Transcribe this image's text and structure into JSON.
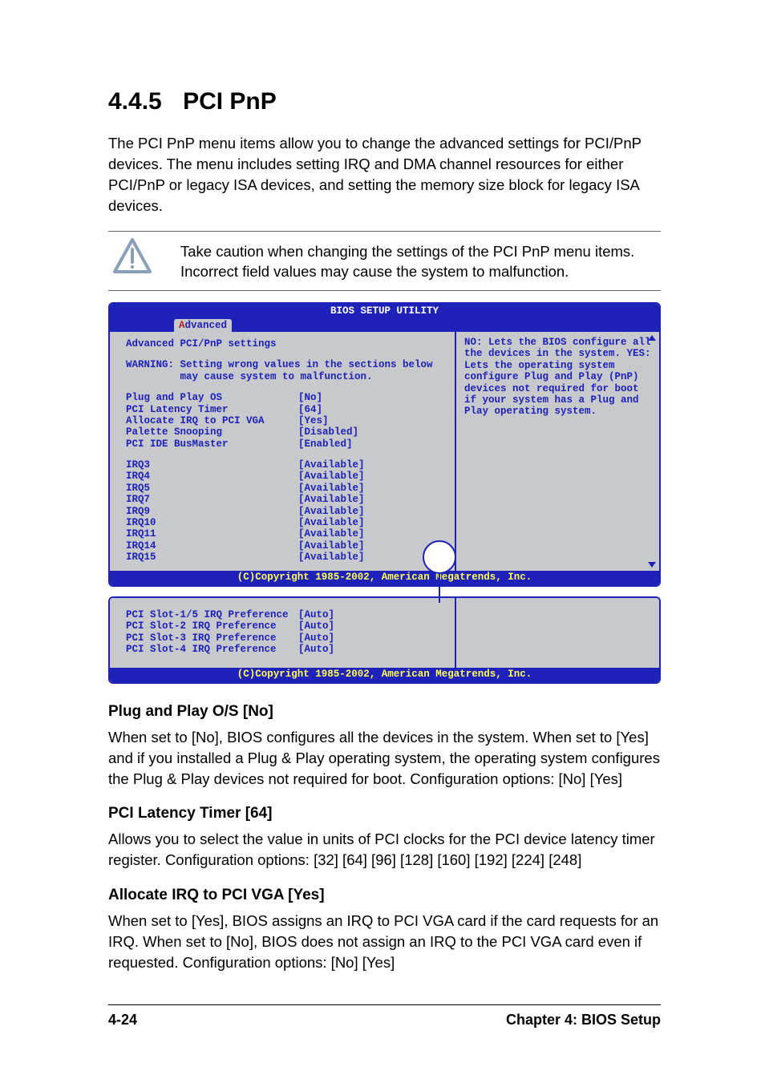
{
  "heading": {
    "num": "4.4.5",
    "title": "PCI PnP"
  },
  "intro": "The PCI PnP menu items allow you to change the advanced settings for PCI/PnP devices. The menu includes setting IRQ and DMA channel resources for either PCI/PnP or legacy ISA devices, and setting the memory size block for legacy ISA devices.",
  "caution": "Take caution when changing the settings of the PCI PnP menu items. Incorrect field values may cause the system to malfunction.",
  "bios": {
    "header": "BIOS SETUP UTILITY",
    "tab_hot": "A",
    "tab_rest": "dvanced",
    "title": "Advanced PCI/PnP settings",
    "warning_l1": "WARNING: Setting wrong values in the sections below",
    "warning_l2": "         may cause system to malfunction.",
    "settings": [
      {
        "label": "Plug and Play OS",
        "value": "[No]"
      },
      {
        "label": "PCI Latency Timer",
        "value": "[64]"
      },
      {
        "label": "Allocate IRQ to PCI VGA",
        "value": "[Yes]"
      },
      {
        "label": "Palette Snooping",
        "value": "[Disabled]"
      },
      {
        "label": "PCI IDE BusMaster",
        "value": "[Enabled]"
      }
    ],
    "irqs": [
      {
        "label": "IRQ3",
        "value": "[Available]"
      },
      {
        "label": "IRQ4",
        "value": "[Available]"
      },
      {
        "label": "IRQ5",
        "value": "[Available]"
      },
      {
        "label": "IRQ7",
        "value": "[Available]"
      },
      {
        "label": "IRQ9",
        "value": "[Available]"
      },
      {
        "label": "IRQ10",
        "value": "[Available]"
      },
      {
        "label": "IRQ11",
        "value": "[Available]"
      },
      {
        "label": "IRQ14",
        "value": "[Available]"
      },
      {
        "label": "IRQ15",
        "value": "[Available]"
      }
    ],
    "help": "NO: Lets the BIOS configure all the devices in the system. YES: Lets the operating system configure Plug and Play (PnP) devices not required for boot if your system has a Plug and Play operating system.",
    "copyright": "(C)Copyright 1985-2002, American Megatrends, Inc.",
    "frag": [
      {
        "label": "PCI Slot-1/5 IRQ Preference",
        "value": "[Auto]"
      },
      {
        "label": "PCI Slot-2 IRQ Preference",
        "value": "[Auto]"
      },
      {
        "label": "PCI Slot-3 IRQ Preference",
        "value": "[Auto]"
      },
      {
        "label": "PCI Slot-4 IRQ Preference",
        "value": "[Auto]"
      }
    ]
  },
  "sections": [
    {
      "heading": "Plug and Play O/S [No]",
      "desc": "When set to [No], BIOS configures all the devices in the system. When set to [Yes] and if you installed a Plug & Play operating system, the operating system configures the Plug & Play devices not required for boot. Configuration options: [No] [Yes]"
    },
    {
      "heading": "PCI Latency Timer [64]",
      "desc": "Allows you to select the value in units of PCI clocks for the PCI device latency timer register. Configuration options: [32] [64] [96] [128] [160] [192] [224] [248]"
    },
    {
      "heading": "Allocate IRQ to PCI VGA [Yes]",
      "desc": "When set to [Yes], BIOS assigns an IRQ to PCI VGA card if the card requests for an IRQ. When set to [No], BIOS does not assign an IRQ to the PCI VGA card even if requested. Configuration options: [No] [Yes]"
    }
  ],
  "footer": {
    "page": "4-24",
    "chapter": "Chapter 4: BIOS Setup"
  }
}
